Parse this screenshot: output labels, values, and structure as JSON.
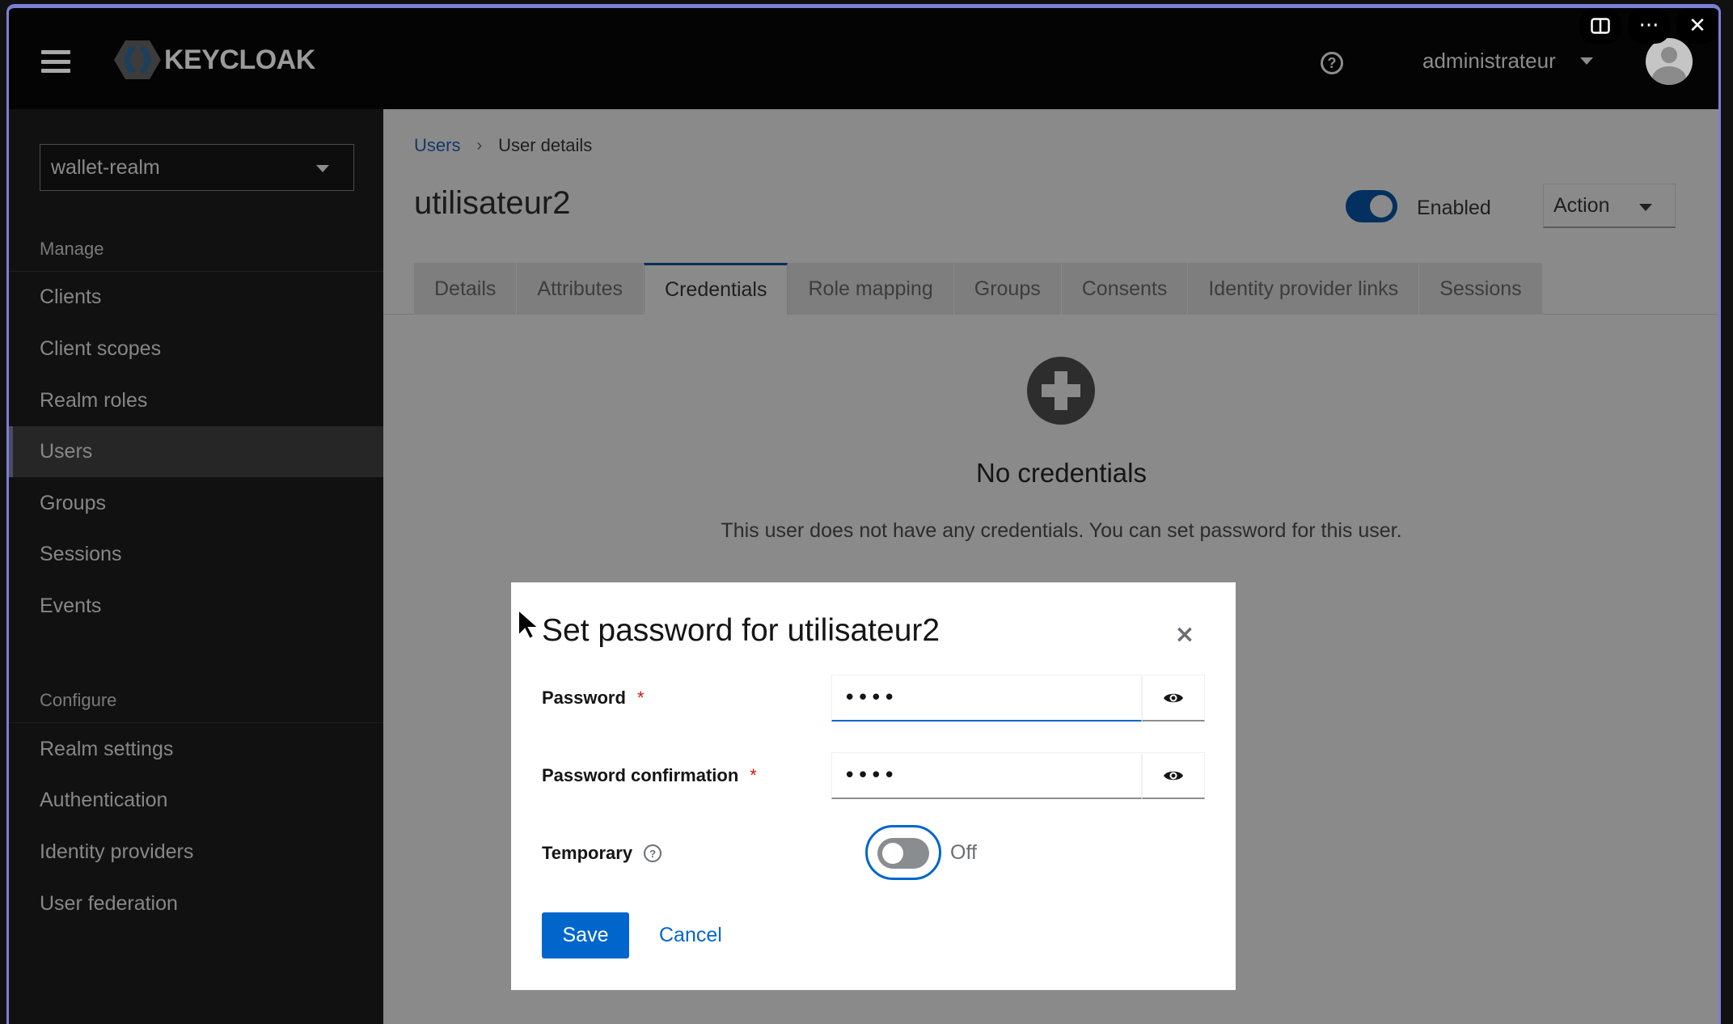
{
  "window": {
    "controls": [
      "split-view-icon",
      "more-icon",
      "close-icon"
    ]
  },
  "header": {
    "logo_text": "KEYCLOAK",
    "username": "administrateur"
  },
  "sidebar": {
    "realm": "wallet-realm",
    "manage_label": "Manage",
    "manage_items": [
      {
        "label": "Clients"
      },
      {
        "label": "Client scopes"
      },
      {
        "label": "Realm roles"
      },
      {
        "label": "Users",
        "active": true
      },
      {
        "label": "Groups"
      },
      {
        "label": "Sessions"
      },
      {
        "label": "Events"
      }
    ],
    "configure_label": "Configure",
    "configure_items": [
      {
        "label": "Realm settings"
      },
      {
        "label": "Authentication"
      },
      {
        "label": "Identity providers"
      },
      {
        "label": "User federation"
      }
    ]
  },
  "main": {
    "breadcrumb": {
      "parent": "Users",
      "current": "User details"
    },
    "title": "utilisateur2",
    "enabled_label": "Enabled",
    "enabled": true,
    "action_label": "Action",
    "tabs": [
      {
        "label": "Details"
      },
      {
        "label": "Attributes"
      },
      {
        "label": "Credentials",
        "active": true
      },
      {
        "label": "Role mapping"
      },
      {
        "label": "Groups"
      },
      {
        "label": "Consents"
      },
      {
        "label": "Identity provider links"
      },
      {
        "label": "Sessions"
      }
    ],
    "empty_state": {
      "title": "No credentials",
      "text": "This user does not have any credentials. You can set password for this user."
    }
  },
  "modal": {
    "title": "Set password for utilisateur2",
    "password_label": "Password",
    "password_value": "••••",
    "confirm_label": "Password confirmation",
    "confirm_value": "••••",
    "required_mark": "*",
    "temporary_label": "Temporary",
    "temporary_state": "Off",
    "save_label": "Save",
    "cancel_label": "Cancel"
  },
  "colors": {
    "primary": "#0066cc",
    "required": "#c9190b",
    "accent_border": "#7b7fd6"
  }
}
